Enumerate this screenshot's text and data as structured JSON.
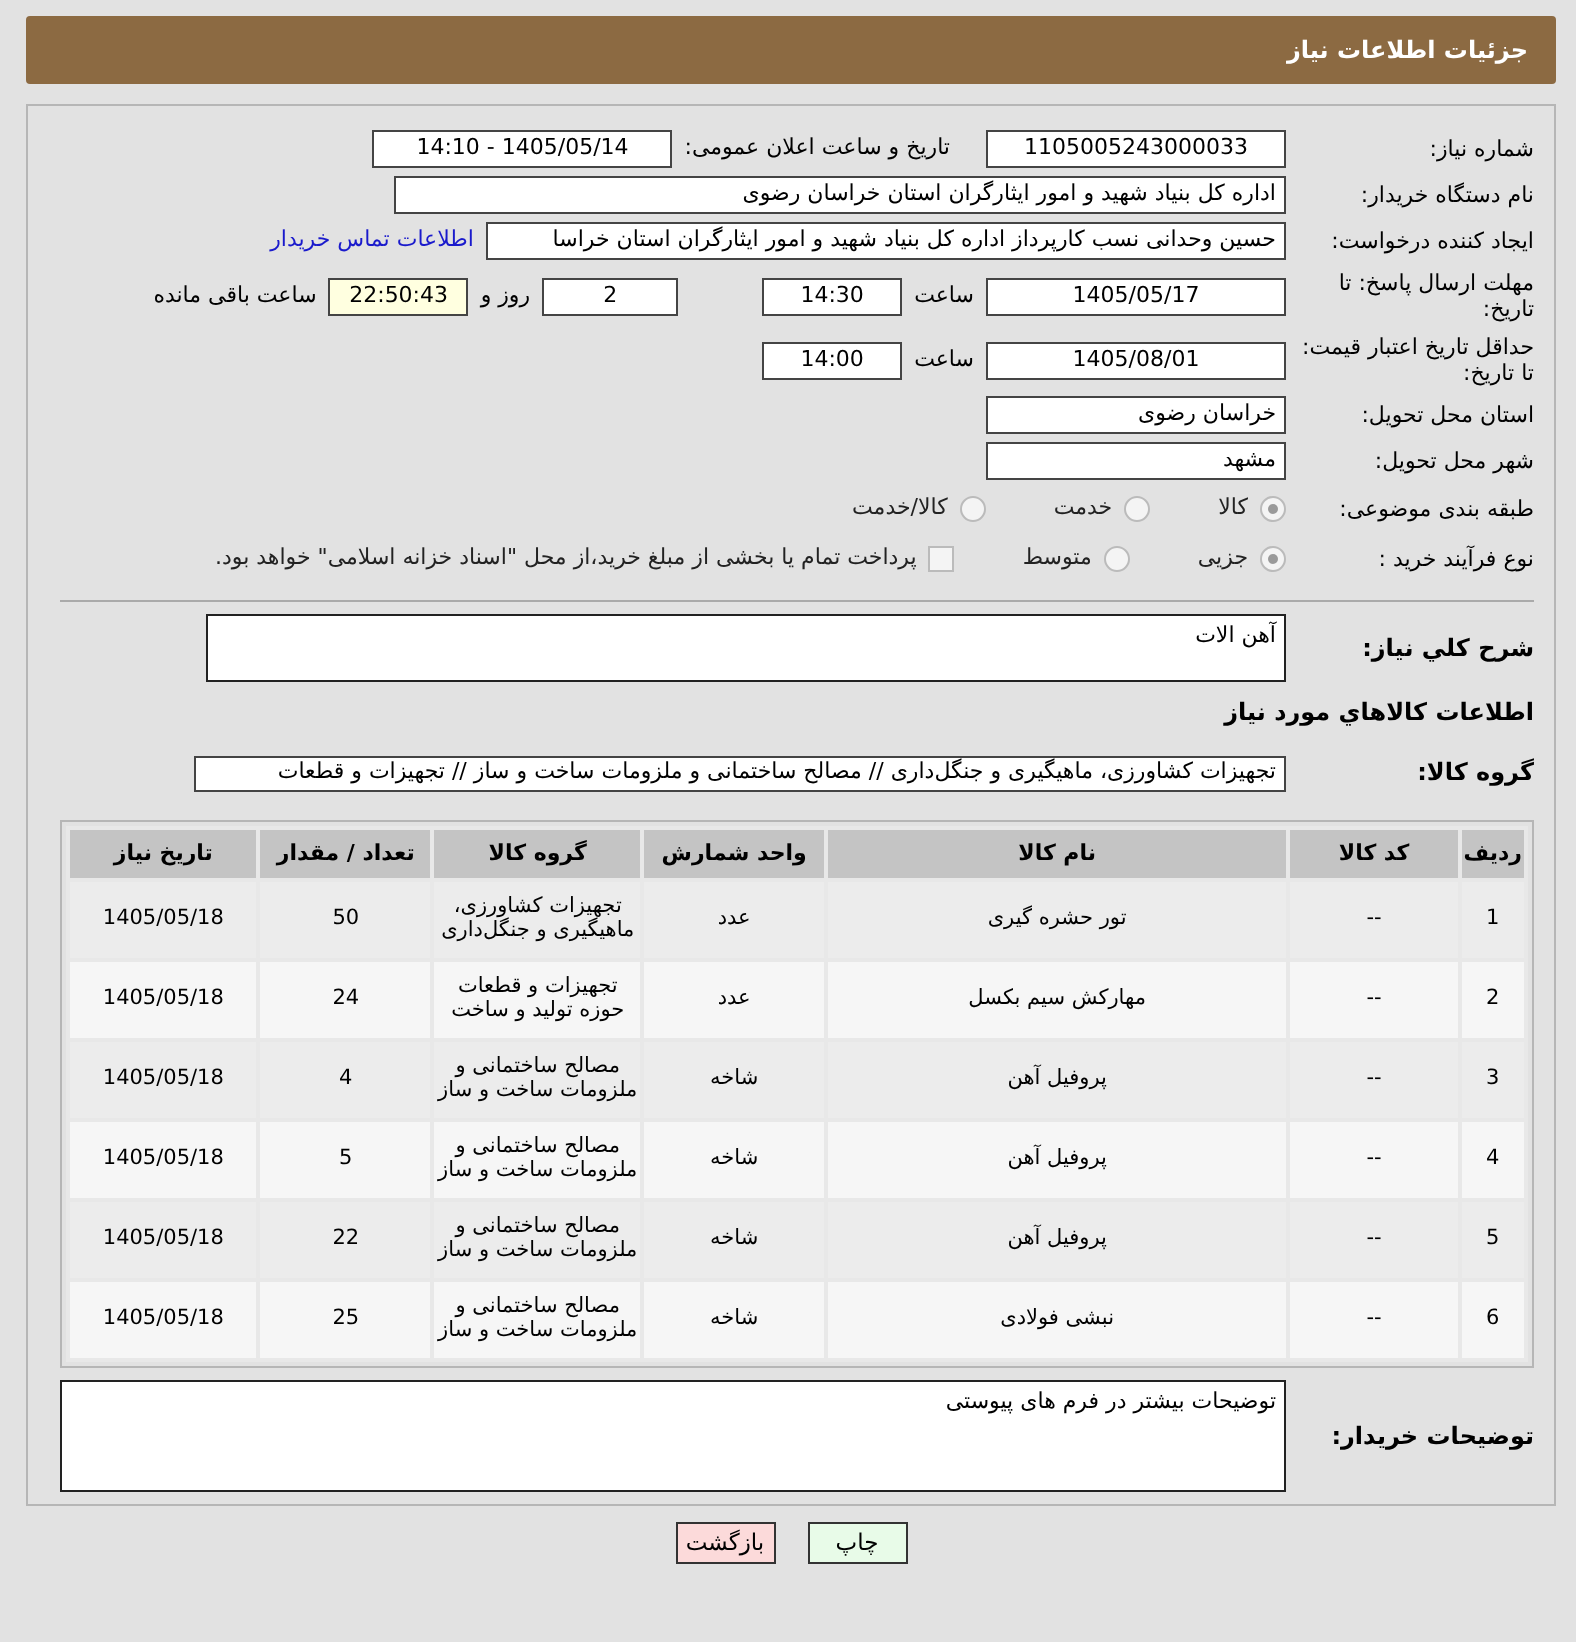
{
  "header": {
    "title": "جزئیات اطلاعات نیاز"
  },
  "need_number": {
    "label": "شماره نیاز:",
    "value": "1105005243000033"
  },
  "announce": {
    "label": "تاریخ و ساعت اعلان عمومی:",
    "value": "1405/05/14 - 14:10"
  },
  "buyer": {
    "label": "نام دستگاه خریدار:",
    "value": "اداره کل بنیاد شهید و امور ایثارگران استان خراسان رضوی"
  },
  "requester": {
    "label": "ایجاد کننده درخواست:",
    "value": "حسین وحدانی نسب کارپرداز اداره کل بنیاد شهید و امور ایثارگران استان خراسا",
    "link": "اطلاعات تماس خریدار"
  },
  "deadline": {
    "label": "مهلت ارسال پاسخ: تا تاریخ:",
    "date": "1405/05/17",
    "time_label": "ساعت",
    "time": "14:30",
    "days": "2",
    "days_label": "روز و",
    "remaining": "22:50:43",
    "remaining_label": "ساعت باقی مانده"
  },
  "validity": {
    "label": "حداقل تاریخ اعتبار قیمت: تا تاریخ:",
    "date": "1405/08/01",
    "time_label": "ساعت",
    "time": "14:00"
  },
  "province": {
    "label": "استان محل تحویل:",
    "value": "خراسان رضوی"
  },
  "city": {
    "label": "شهر محل تحویل:",
    "value": "مشهد"
  },
  "category": {
    "label": "طبقه بندی موضوعی:",
    "options": [
      {
        "label": "کالا",
        "selected": true
      },
      {
        "label": "خدمت",
        "selected": false
      },
      {
        "label": "کالا/خدمت",
        "selected": false
      }
    ]
  },
  "process": {
    "label": "نوع فرآیند خرید :",
    "options": [
      {
        "label": "جزیی",
        "selected": true
      },
      {
        "label": "متوسط",
        "selected": false
      }
    ],
    "payment": {
      "checked": false,
      "label": "پرداخت تمام یا بخشی از مبلغ خرید،از محل \"اسناد خزانه اسلامی\" خواهد بود."
    }
  },
  "description": {
    "label": "شرح كلي نياز:",
    "value": "آهن الات"
  },
  "goods_heading": "اطلاعات كالاهاي مورد نياز",
  "goods_group": {
    "label": "گروه کالا:",
    "value": "تجهیزات کشاورزی، ماهیگیری و جنگل‌داری // مصالح ساختمانی و ملزومات ساخت و ساز // تجهیزات و قطعات"
  },
  "table": {
    "columns": [
      "ردیف",
      "کد کالا",
      "نام کالا",
      "واحد شمارش",
      "گروه کالا",
      "تعداد / مقدار",
      "تاریخ نیاز"
    ],
    "rows": [
      [
        "1",
        "--",
        "تور حشره گیری",
        "عدد",
        "تجهیزات کشاورزی، ماهیگیری و جنگل‌داری",
        "50",
        "1405/05/18"
      ],
      [
        "2",
        "--",
        "مهارکش سیم بکسل",
        "عدد",
        "تجهیزات و قطعات حوزه تولید و ساخت",
        "24",
        "1405/05/18"
      ],
      [
        "3",
        "--",
        "پروفیل آهن",
        "شاخه",
        "مصالح ساختمانی و ملزومات ساخت و ساز",
        "4",
        "1405/05/18"
      ],
      [
        "4",
        "--",
        "پروفیل آهن",
        "شاخه",
        "مصالح ساختمانی و ملزومات ساخت و ساز",
        "5",
        "1405/05/18"
      ],
      [
        "5",
        "--",
        "پروفیل آهن",
        "شاخه",
        "مصالح ساختمانی و ملزومات ساخت و ساز",
        "22",
        "1405/05/18"
      ],
      [
        "6",
        "--",
        "نبشی فولادی",
        "شاخه",
        "مصالح ساختمانی و ملزومات ساخت و ساز",
        "25",
        "1405/05/18"
      ]
    ]
  },
  "buyer_notes": {
    "label": "توضیحات خریدار:",
    "value": "توضیحات بیشتر در فرم های پیوستی"
  },
  "buttons": [
    {
      "label": "چاپ",
      "kind": "print"
    },
    {
      "label": "بازگشت",
      "kind": "back"
    }
  ]
}
